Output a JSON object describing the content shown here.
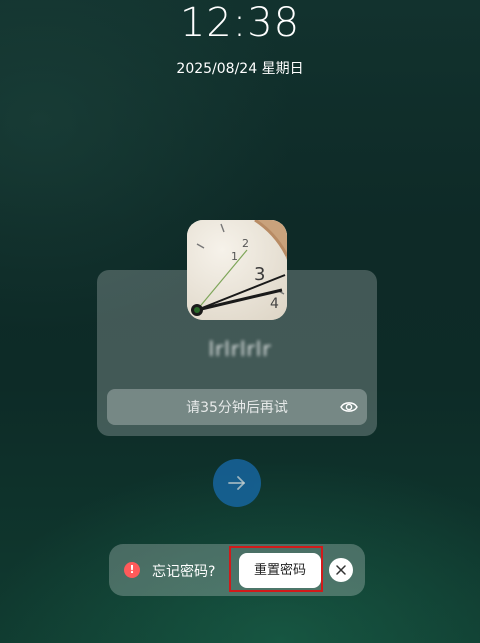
{
  "lockscreen": {
    "time": "12:38",
    "date": "2025/08/24 星期日"
  },
  "user": {
    "avatar_icon": "clock-photo-avatar",
    "name_blurred": "lrlrlrlr"
  },
  "password": {
    "placeholder": "请35分钟后再试",
    "reveal_icon": "eye-icon"
  },
  "submit": {
    "icon": "arrow-right-icon",
    "color": "#1769a8"
  },
  "forgot": {
    "icon": "warning-icon",
    "warning_glyph": "!",
    "text": "忘记密码?",
    "reset_label": "重置密码",
    "close_icon": "close-icon",
    "highlight_color": "#d11a1a"
  }
}
